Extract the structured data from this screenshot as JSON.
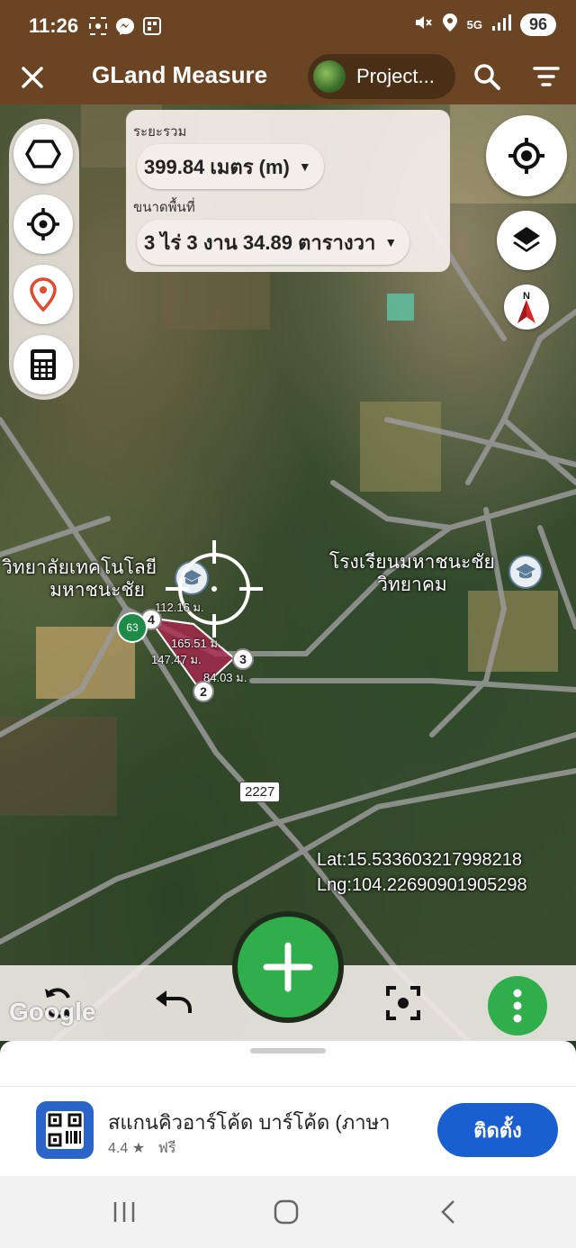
{
  "status_bar": {
    "time": "11:26",
    "network": "5G",
    "battery": "96",
    "left_icons": [
      "screenshot-icon",
      "messenger-icon",
      "gallery-icon"
    ],
    "right_icons": [
      "mute-icon",
      "location-icon",
      "5g-icon",
      "signal-icon",
      "battery-icon"
    ]
  },
  "app_bar": {
    "title": "GLand Measure",
    "project_label": "Project...",
    "icons": [
      "close-icon",
      "search-icon",
      "filter-icon"
    ]
  },
  "measure": {
    "distance_label": "ระยะรวม",
    "distance_value": "399.84 เมตร (m)",
    "area_label": "ขนาดพื้นที่",
    "area_value": "3 ไร่ 3 งาน 34.89 ตารางวา"
  },
  "map": {
    "places": [
      {
        "name_line1": "วิทยาลัยเทคโนโลยี",
        "name_line2": "มหาชนะชัย"
      },
      {
        "name_line1": "โรงเรียนมหาชนะชัย",
        "name_line2": "วิทยาคม"
      }
    ],
    "distances": [
      "112.16 ม.",
      "165.51 ม.",
      "147.47 ม.",
      "84.03 ม."
    ],
    "vertices": [
      "2",
      "3",
      "4"
    ],
    "route_badge": "63",
    "road_shield": "2227",
    "lat": "Lat:15.533603217998218",
    "lng": "Lng:104.22690901905298",
    "google_logo": "Google",
    "accent_color": "#2fae4b",
    "polygon_color": "#b0234f"
  },
  "ad": {
    "app_name": "สแกนคิวอาร์โค้ด บาร์โค้ด (ภาษา",
    "rating": "4.4 ★",
    "price": "ฟรี",
    "install_label": "ติดตั้ง"
  }
}
